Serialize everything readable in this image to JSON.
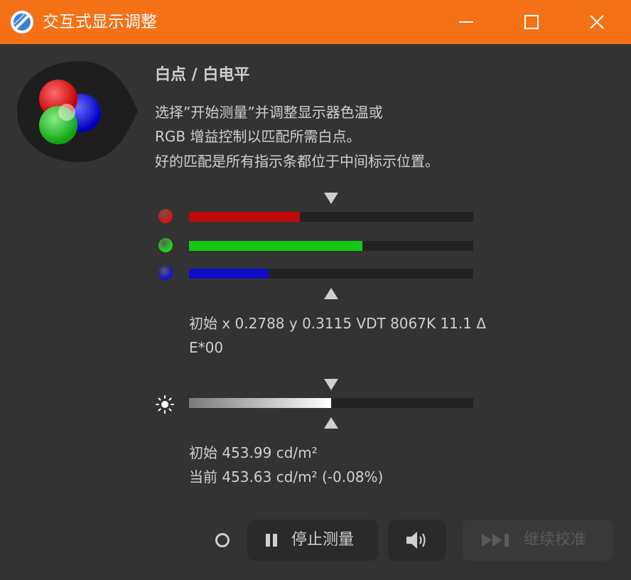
{
  "window": {
    "title": "交互式显示调整",
    "title_bar_color": "#f47116",
    "controls": [
      "minimize-icon",
      "maximize-icon",
      "close-icon"
    ]
  },
  "section": {
    "heading": "白点 / 白电平",
    "description": [
      "选择”开始测量”并调整显示器色温或",
      "RGB 增益控制以匹配所需白点。",
      "好的匹配是所有指示条都位于中间标示位置。"
    ]
  },
  "rgb_meters": [
    {
      "channel": "red",
      "dot_color": "#e01010",
      "bar_color": "#c00a0a",
      "level": 0.39
    },
    {
      "channel": "green",
      "dot_color": "#1ed21e",
      "bar_color": "#14c814",
      "level": 0.61
    },
    {
      "channel": "blue",
      "dot_color": "#1414d8",
      "bar_color": "#0e0ec8",
      "level": 0.28
    }
  ],
  "rgb_target_marker": 0.5,
  "color_readout": {
    "line1": "初始 x 0.2788 y 0.3115 VDT 8067K 11.1 Δ",
    "line2": "E*00"
  },
  "luminance_meter": {
    "level": 0.5,
    "target_marker": 0.5
  },
  "luminance_readout": {
    "initial": "初始 453.99 cd/m²",
    "current": "当前 453.63 cd/m² (-0.08%)"
  },
  "buttons": {
    "stop_label": "停止测量",
    "stop_icon": "pause-icon",
    "sound_icon": "speaker-icon",
    "continue_label": "继续校准",
    "continue_icon": "skip-forward-icon",
    "continue_enabled": false
  },
  "colors": {
    "background": "#333333",
    "text": "#cfcfcf",
    "track": "#222222",
    "disabled_text": "#5a5a5a"
  }
}
